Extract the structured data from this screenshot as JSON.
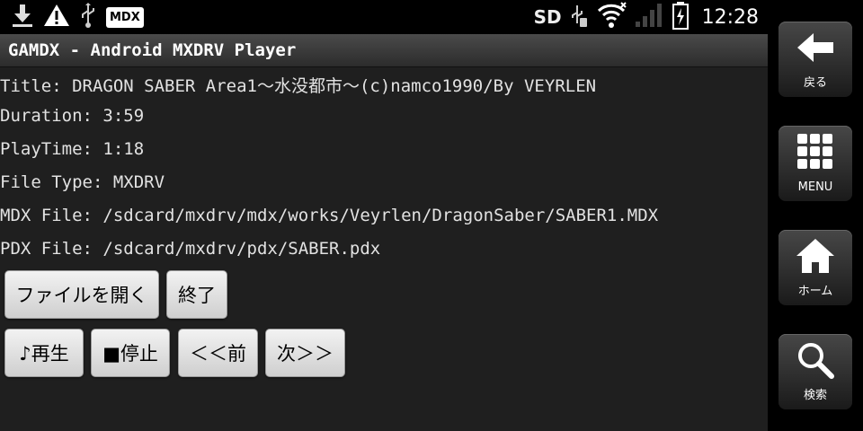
{
  "statusbar": {
    "left_icons": [
      "download-icon",
      "warning-icon",
      "usb-icon"
    ],
    "app_badge": "MDX",
    "storage_label": "SD",
    "time": "12:28"
  },
  "app": {
    "title": "GAMDX - Android MXDRV Player"
  },
  "info": {
    "title_line": "Title: DRAGON SABER Area1～水没都市～(c)namco1990/By VEYRLEN",
    "duration_line": "Duration: 3:59",
    "playtime_line": "PlayTime: 1:18",
    "filetype_line": "File Type: MXDRV",
    "mdx_line": "MDX File: /sdcard/mxdrv/mdx/works/Veyrlen/DragonSaber/SABER1.MDX",
    "pdx_line": "PDX File: /sdcard/mxdrv/pdx/SABER.pdx"
  },
  "buttons": {
    "open_file": "ファイルを開く",
    "exit": "終了",
    "play": "♪再生",
    "stop": "■停止",
    "prev": "＜＜前",
    "next": "次＞＞"
  },
  "navbar": {
    "back": "戻る",
    "menu": "MENU",
    "home": "ホーム",
    "search": "検索"
  }
}
